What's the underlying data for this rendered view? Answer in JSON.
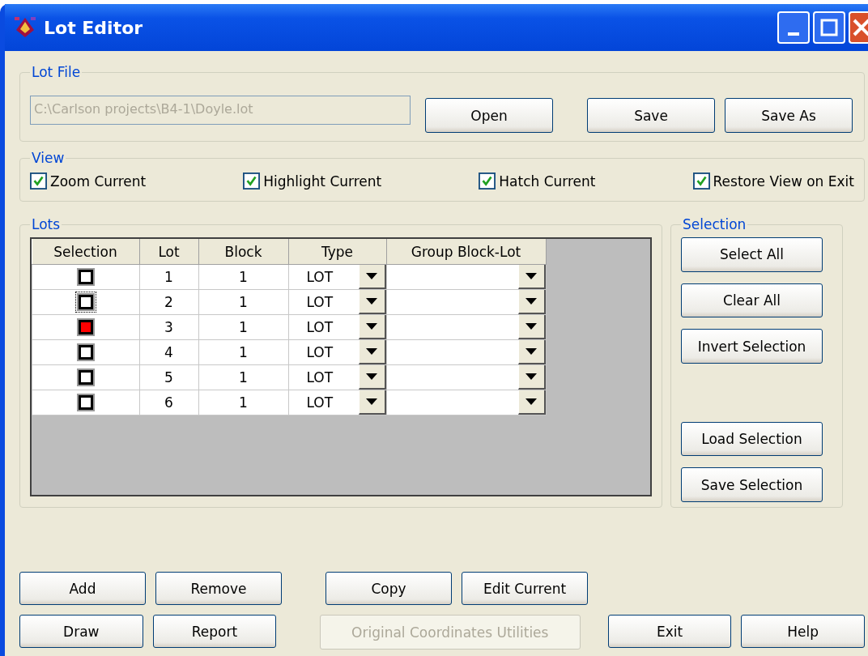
{
  "window": {
    "title": "Lot Editor"
  },
  "lot_file": {
    "label": "Lot File",
    "path": "C:\\Carlson projects\\B4-1\\Doyle.lot",
    "buttons": [
      {
        "label": "Open",
        "disabled": false
      },
      {
        "label": "Save",
        "disabled": false
      },
      {
        "label": "Save As",
        "disabled": false
      }
    ]
  },
  "view": {
    "label": "View",
    "options": [
      {
        "label": "Zoom Current",
        "checked": true
      },
      {
        "label": "Highlight Current",
        "checked": true
      },
      {
        "label": "Hatch Current",
        "checked": true
      },
      {
        "label": "Restore View on Exit",
        "checked": true
      }
    ]
  },
  "lots": {
    "label": "Lots",
    "columns": [
      "Selection",
      "Lot",
      "Block",
      "Type",
      "Group Block-Lot"
    ],
    "rows": [
      {
        "selected": false,
        "focused": false,
        "lot": "1",
        "block": "1",
        "type": "LOT"
      },
      {
        "selected": false,
        "focused": true,
        "lot": "2",
        "block": "1",
        "type": "LOT"
      },
      {
        "selected": true,
        "focused": false,
        "lot": "3",
        "block": "1",
        "type": "LOT"
      },
      {
        "selected": false,
        "focused": false,
        "lot": "4",
        "block": "1",
        "type": "LOT"
      },
      {
        "selected": false,
        "focused": false,
        "lot": "5",
        "block": "1",
        "type": "LOT"
      },
      {
        "selected": false,
        "focused": false,
        "lot": "6",
        "block": "1",
        "type": "LOT"
      }
    ]
  },
  "selection": {
    "label": "Selection",
    "buttons": [
      {
        "label": "Select All",
        "disabled": false
      },
      {
        "label": "Clear All",
        "disabled": false
      },
      {
        "label": "Invert Selection",
        "disabled": false
      },
      {
        "label": "Load Selection",
        "disabled": false
      },
      {
        "label": "Save Selection",
        "disabled": false
      }
    ]
  },
  "bottom_rows": [
    [
      {
        "label": "Add",
        "disabled": false
      },
      {
        "label": "Remove",
        "disabled": false
      },
      {
        "label": "Copy",
        "disabled": false
      },
      {
        "label": "Edit Current",
        "disabled": false
      }
    ],
    [
      {
        "label": "Draw",
        "disabled": false
      },
      {
        "label": "Report",
        "disabled": false
      },
      {
        "label": "Original Coordinates Utilities",
        "disabled": true
      },
      {
        "label": "Exit",
        "disabled": false
      },
      {
        "label": "Help",
        "disabled": false
      }
    ]
  ]
}
